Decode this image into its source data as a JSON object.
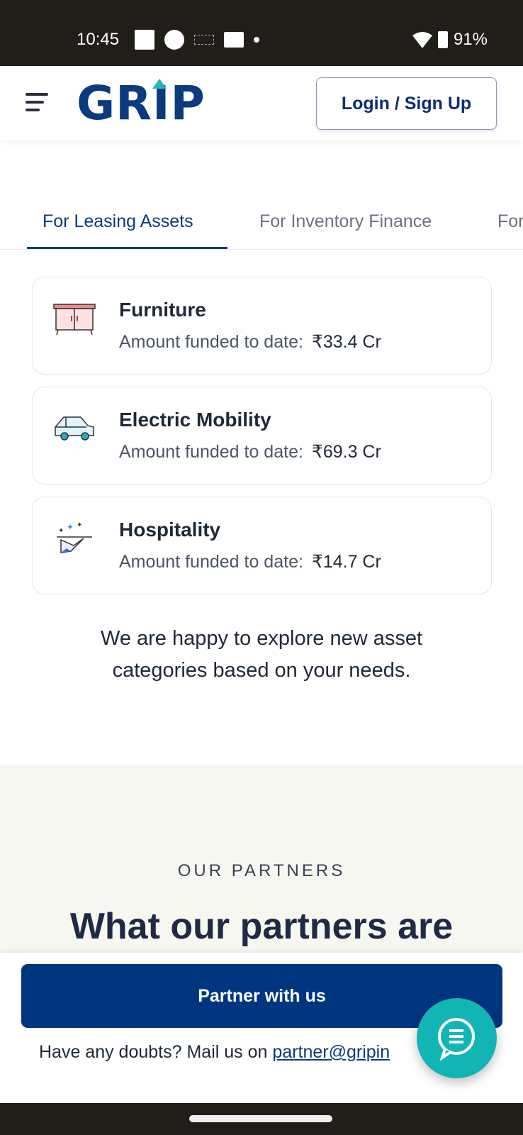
{
  "status_bar": {
    "time": "10:45",
    "battery": "91%"
  },
  "header": {
    "logo": "GRIP",
    "login_label": "Login / Sign Up"
  },
  "tabs": [
    {
      "label": "For Leasing Assets",
      "active": true
    },
    {
      "label": "For Inventory Finance",
      "active": false
    },
    {
      "label": "For",
      "active": false
    }
  ],
  "cards": [
    {
      "title": "Furniture",
      "label": "Amount funded to date:",
      "value": "₹33.4 Cr",
      "icon": "cabinet-icon"
    },
    {
      "title": "Electric Mobility",
      "label": "Amount funded to date:",
      "value": "₹69.3 Cr",
      "icon": "car-icon"
    },
    {
      "title": "Hospitality",
      "label": "Amount funded to date:",
      "value": "₹14.7 Cr",
      "icon": "serving-tray-icon"
    }
  ],
  "note": "We are happy to explore new asset categories based on your needs.",
  "partners": {
    "kicker": "OUR PARTNERS",
    "heading": "What our partners are"
  },
  "cta": {
    "button": "Partner with us",
    "mail_prefix": "Have any doubts? Mail us on",
    "mail_link": "partner@gripin"
  },
  "colors": {
    "brand": "#0b3a7e",
    "button": "#003580",
    "accent": "#12b5b4"
  }
}
